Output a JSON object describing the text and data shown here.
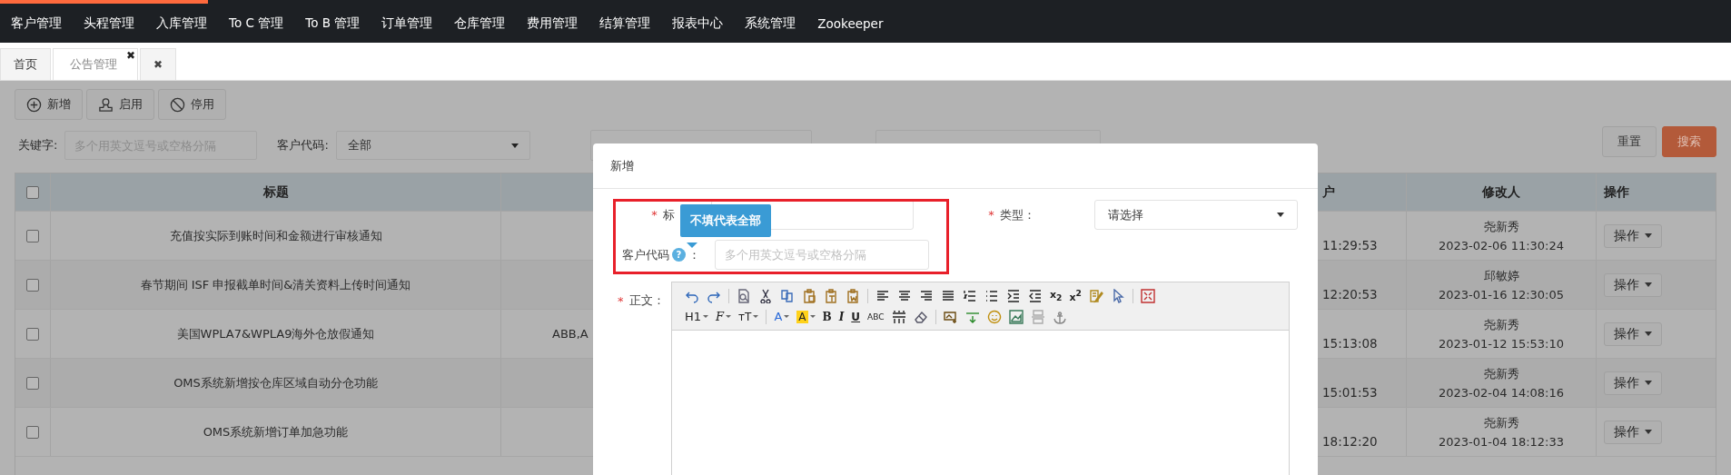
{
  "progress": {
    "level": 0.12
  },
  "nav": [
    "客户管理",
    "头程管理",
    "入库管理",
    "To C 管理",
    "To B 管理",
    "订单管理",
    "仓库管理",
    "费用管理",
    "结算管理",
    "报表中心",
    "系统管理",
    "Zookeeper"
  ],
  "tabs": [
    {
      "label": "首页",
      "selected": false
    },
    {
      "label": "公告管理",
      "selected": true,
      "close": "✖"
    },
    {
      "selected": false,
      "close": "✖"
    }
  ],
  "toolbar": [
    {
      "kind": "add",
      "label": "新增"
    },
    {
      "kind": "enable",
      "label": "启用"
    },
    {
      "kind": "disable",
      "label": "停用"
    }
  ],
  "filters": {
    "keyword_label": "关键字:",
    "keyword_placeholder": "多个用英文逗号或空格分隔",
    "customer_label": "客户代码:",
    "customer_value": "全部",
    "reset": "重置",
    "search": "搜索"
  },
  "table": {
    "select_all_checked": false,
    "columns": [
      "标题",
      "",
      "户",
      "修改人",
      "操作"
    ],
    "rows": [
      {
        "checked": false,
        "title": "充值按实际到账时间和金额进行审核通知",
        "column_2": "",
        "column_3": "11:29:53",
        "modifier": "尧新秀",
        "modified": "2023-02-06 11:30:24",
        "action": "操作"
      },
      {
        "checked": false,
        "title": "春节期间 ISF 申报截单时间&清关资料上传时间通知",
        "column_2": "",
        "column_3": "12:20:53",
        "modifier": "邱敏婷",
        "modified": "2023-01-16 12:30:05",
        "action": "操作"
      },
      {
        "checked": false,
        "title": "美国WPLA7&WPLA9海外仓放假通知",
        "column_2": "ABB,A",
        "column_3": "15:13:08",
        "modifier": "尧新秀",
        "modified": "2023-01-12 15:53:10",
        "action": "操作"
      },
      {
        "checked": false,
        "title": "OMS系统新增按仓库区域自动分仓功能",
        "column_2": "",
        "column_3": "15:01:53",
        "modifier": "尧新秀",
        "modified": "2023-02-04 14:08:16",
        "action": "操作"
      },
      {
        "checked": false,
        "title": "OMS系统新增订单加急功能",
        "column_2": "",
        "column_3": "18:12:20",
        "modifier": "尧新秀",
        "modified": "2023-01-04 18:12:33",
        "action": "操作"
      }
    ]
  },
  "dialog": {
    "title": "新增",
    "title_label": "标",
    "required": "*",
    "type_label": "类型：",
    "type_value": "请选择",
    "customer_label": "客户代码",
    "help": "?",
    "colon": "：",
    "customer_placeholder": "多个用英文逗号或空格分隔",
    "tooltip": "不填代表全部",
    "body_label": "正文：",
    "editor_rows": [
      [
        {
          "kind": "undo"
        },
        {
          "kind": "redo"
        },
        {
          "kind": "separator"
        },
        {
          "kind": "magnifier-page"
        },
        {
          "kind": "scissors"
        },
        {
          "kind": "copy-pages"
        },
        {
          "kind": "clipboard"
        },
        {
          "kind": "clipboard-text"
        },
        {
          "kind": "clipboard-word"
        },
        {
          "kind": "separator"
        },
        {
          "kind": "align-left"
        },
        {
          "kind": "align-center"
        },
        {
          "kind": "align-right"
        },
        {
          "kind": "align-justify"
        },
        {
          "kind": "numbered-list"
        },
        {
          "kind": "bullet-list"
        },
        {
          "kind": "indent"
        },
        {
          "kind": "outdent"
        },
        {
          "kind": "subscript",
          "text": "x$_{2}$"
        },
        {
          "kind": "superscript",
          "text": "x$^{2}$"
        },
        {
          "kind": "pencil-note"
        },
        {
          "kind": "cursor"
        },
        {
          "kind": "separator"
        },
        {
          "kind": "fullscreen"
        }
      ],
      [
        {
          "kind": "heading",
          "text": "H1",
          "dropdown": true
        },
        {
          "kind": "font",
          "text": "F",
          "dropdown": true
        },
        {
          "kind": "size",
          "text": "ᴛT",
          "dropdown": true
        },
        {
          "kind": "separator"
        },
        {
          "kind": "color",
          "text": "A",
          "dropdown": true
        },
        {
          "kind": "highlight",
          "text": "A",
          "dropdown": true
        },
        {
          "kind": "bold",
          "text": "B"
        },
        {
          "kind": "italic",
          "text": "I"
        },
        {
          "kind": "underline",
          "text": "U"
        },
        {
          "kind": "strike",
          "text": "ABC"
        },
        {
          "kind": "dotted-lines"
        },
        {
          "kind": "eraser"
        },
        {
          "kind": "separator"
        },
        {
          "kind": "image-add"
        },
        {
          "kind": "line-add"
        },
        {
          "kind": "smiley"
        },
        {
          "kind": "picture"
        },
        {
          "kind": "page-break"
        },
        {
          "kind": "anchor"
        }
      ]
    ]
  }
}
